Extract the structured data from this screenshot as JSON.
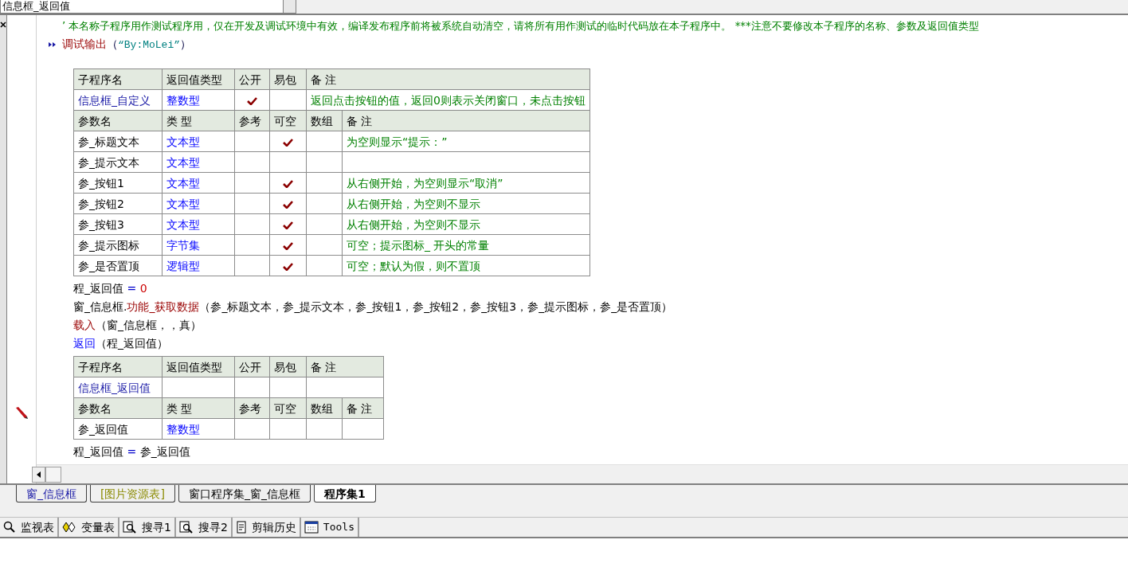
{
  "selector": {
    "value": "信息框_返回值"
  },
  "comment": "’ 本名称子程序用作测试程序用，仅在开发及调试环境中有效，编译发布程序前将被系统自动清空，请将所有用作测试的临时代码放在本子程序中。 ***注意不要修改本子程序的名称、参数及返回值类型",
  "debug_line": [
    {
      "kind": "command",
      "text": "调试输出"
    },
    {
      "kind": "paren",
      "text": "（"
    },
    {
      "kind": "string",
      "text": "“By:MoLei”"
    },
    {
      "kind": "paren",
      "text": "）"
    }
  ],
  "subroutines": [
    {
      "header": [
        "子程序名",
        "返回值类型",
        "公开",
        "易包",
        "备 注"
      ],
      "name": "信息框_自定义",
      "return_type": "整数型",
      "public": true,
      "easy_package": false,
      "note": "返回点击按钮的值，返回0则表示关闭窗口，未点击按钮",
      "param_header": [
        "参数名",
        "类 型",
        "参考",
        "可空",
        "数组",
        "备 注"
      ],
      "params": [
        {
          "name": "参_标题文本",
          "type": "文本型",
          "reference": false,
          "nullable": true,
          "array": false,
          "note": "为空则显示“提示：”"
        },
        {
          "name": "参_提示文本",
          "type": "文本型",
          "reference": false,
          "nullable": false,
          "array": false
        },
        {
          "name": "参_按钮1",
          "type": "文本型",
          "reference": false,
          "nullable": true,
          "array": false,
          "note": "从右侧开始，为空则显示“取消”"
        },
        {
          "name": "参_按钮2",
          "type": "文本型",
          "reference": false,
          "nullable": true,
          "array": false,
          "note": "从右侧开始，为空则不显示"
        },
        {
          "name": "参_按钮3",
          "type": "文本型",
          "reference": false,
          "nullable": true,
          "array": false,
          "note": "从右侧开始，为空则不显示"
        },
        {
          "name": "参_提示图标",
          "type": "字节集",
          "reference": false,
          "nullable": true,
          "array": false,
          "note": "可空；提示图标_ 开头的常量"
        },
        {
          "name": "参_是否置顶",
          "type": "逻辑型",
          "reference": false,
          "nullable": true,
          "array": false,
          "note": "可空；默认为假，则不置顶"
        }
      ],
      "body": [
        [
          {
            "kind": "text",
            "text": "程_返回值"
          },
          {
            "kind": "op",
            "text": " = "
          },
          {
            "kind": "number",
            "text": "0"
          }
        ],
        [
          {
            "kind": "text",
            "text": "窗_信息框."
          },
          {
            "kind": "command",
            "text": "功能_获取数据"
          },
          {
            "kind": "text",
            "text": "（参_标题文本，参_提示文本，参_按钮1，参_按钮2，参_按钮3，参_提示图标，参_是否置顶）"
          }
        ],
        [
          {
            "kind": "command",
            "text": "载入"
          },
          {
            "kind": "text",
            "text": "（窗_信息框，，真）"
          }
        ],
        [
          {
            "kind": "flow",
            "text": "返回"
          },
          {
            "kind": "text",
            "text": "（程_返回值）"
          }
        ]
      ]
    },
    {
      "header": [
        "子程序名",
        "返回值类型",
        "公开",
        "易包",
        "备 注"
      ],
      "name": "信息框_返回值",
      "public": false,
      "easy_package": false,
      "param_header": [
        "参数名",
        "类 型",
        "参考",
        "可空",
        "数组",
        "备 注"
      ],
      "params": [
        {
          "name": "参_返回值",
          "type": "整数型",
          "reference": false,
          "nullable": false,
          "array": false
        }
      ],
      "body": [
        [
          {
            "kind": "text",
            "text": "程_返回值"
          },
          {
            "kind": "op",
            "text": " = "
          },
          {
            "kind": "text",
            "text": "参_返回值"
          }
        ]
      ]
    }
  ],
  "file_tabs": [
    {
      "label": "窗_信息框",
      "kind": "window",
      "selected": false
    },
    {
      "label": "[图片资源表]",
      "kind": "resource",
      "selected": false
    },
    {
      "label": "窗口程序集_窗_信息框",
      "kind": "plain",
      "selected": false
    },
    {
      "label": "程序集1",
      "kind": "plain",
      "selected": true
    }
  ],
  "toolbar": [
    {
      "label": "监视表",
      "kind": "watch"
    },
    {
      "label": "变量表",
      "kind": "variables"
    },
    {
      "label": "搜寻1",
      "kind": "find"
    },
    {
      "label": "搜寻2",
      "kind": "find"
    },
    {
      "label": "剪辑历史",
      "kind": "clip"
    },
    {
      "label": "Tools",
      "kind": "tools"
    }
  ]
}
